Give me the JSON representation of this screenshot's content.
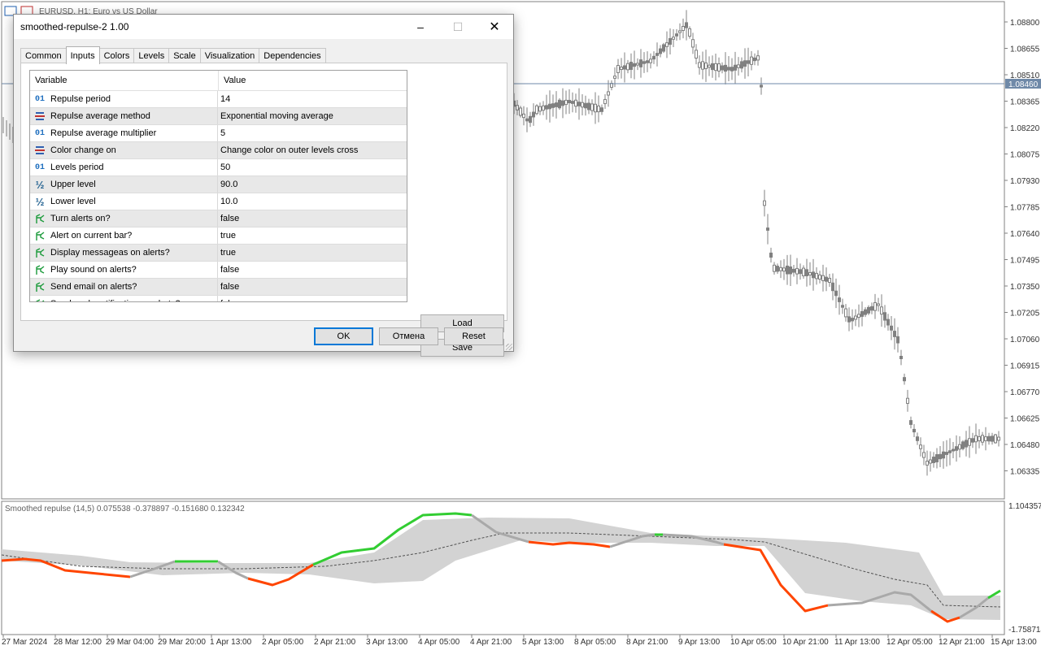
{
  "chart_window": {
    "symbol_label": "EURUSD, H1:  Euro vs US Dollar",
    "price_ticks": [
      "1.08800",
      "1.08655",
      "1.08510",
      "1.08365",
      "1.08220",
      "1.08075",
      "1.07930",
      "1.07785",
      "1.07640",
      "1.07495",
      "1.07350",
      "1.07205",
      "1.07060",
      "1.06915",
      "1.06770",
      "1.06625",
      "1.06480",
      "1.06335"
    ],
    "current_price": "1.08460",
    "indicator_label": "Smoothed repulse (14,5) 0.075538 -0.378897 -0.151680 0.132342",
    "indicator_max": "1.104357",
    "indicator_min": "-1.758714",
    "time_ticks": [
      "27 Mar 2024",
      "28 Mar 12:00",
      "29 Mar 04:00",
      "29 Mar 20:00",
      "1 Apr 13:00",
      "2 Apr 05:00",
      "2 Apr 21:00",
      "3 Apr 13:00",
      "4 Apr 05:00",
      "4 Apr 21:00",
      "5 Apr 13:00",
      "8 Apr 05:00",
      "8 Apr 21:00",
      "9 Apr 13:00",
      "10 Apr 05:00",
      "10 Apr 21:00",
      "11 Apr 13:00",
      "12 Apr 05:00",
      "12 Apr 21:00",
      "15 Apr 13:00"
    ],
    "colors": {
      "up": "#32cd32",
      "down": "#ff4500",
      "neutral": "#a9a9a9",
      "band": "#d3d3d3",
      "candle": "#808080"
    }
  },
  "dialog": {
    "title": "smoothed-repulse-2 1.00",
    "minimize_icon": "–",
    "maximize_icon": "☐",
    "close_icon": "✕",
    "tabs": [
      "Common",
      "Inputs",
      "Colors",
      "Levels",
      "Scale",
      "Visualization",
      "Dependencies"
    ],
    "active_tab": "Inputs",
    "grid": {
      "col_variable": "Variable",
      "col_value": "Value",
      "rows": [
        {
          "icon": "int-icon",
          "label": "Repulse period",
          "value": "14"
        },
        {
          "icon": "enum-icon",
          "label": "Repulse average method",
          "value": "Exponential moving average"
        },
        {
          "icon": "int-icon",
          "label": "Repulse average multiplier",
          "value": "5"
        },
        {
          "icon": "enum-icon",
          "label": "Color change on",
          "value": "Change color on outer levels cross"
        },
        {
          "icon": "int-icon",
          "label": "Levels period",
          "value": "50"
        },
        {
          "icon": "double-icon",
          "label": "Upper level",
          "value": "90.0"
        },
        {
          "icon": "double-icon",
          "label": "Lower level",
          "value": "10.0"
        },
        {
          "icon": "bool-icon",
          "label": "Turn alerts on?",
          "value": "false"
        },
        {
          "icon": "bool-icon",
          "label": "Alert on current bar?",
          "value": "true"
        },
        {
          "icon": "bool-icon",
          "label": "Display messageas on alerts?",
          "value": "true"
        },
        {
          "icon": "bool-icon",
          "label": "Play sound on alerts?",
          "value": "false"
        },
        {
          "icon": "bool-icon",
          "label": "Send email on alerts?",
          "value": "false"
        },
        {
          "icon": "bool-icon",
          "label": "Send push notification on alerts?",
          "value": "false"
        }
      ]
    },
    "icon_glyphs": {
      "int": "01",
      "double": "½"
    },
    "buttons": {
      "load": "Load",
      "save": "Save",
      "ok": "OK",
      "cancel": "Отмена",
      "reset": "Reset"
    }
  }
}
